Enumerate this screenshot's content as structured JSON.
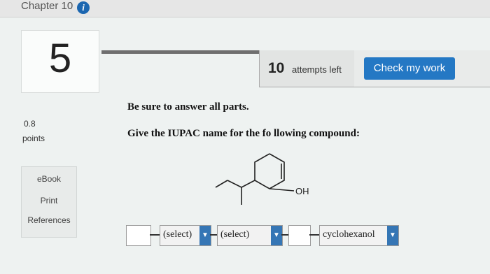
{
  "header": {
    "chapter_title": "Chapter 10",
    "info_icon": "info-icon"
  },
  "question": {
    "number": "5",
    "attempts_count": "10",
    "attempts_label": "attempts left",
    "check_button": "Check my work",
    "instruction": "Be sure to answer all parts.",
    "prompt": "Give the IUPAC name for the fo llowing compound:"
  },
  "points": {
    "value": "0.8",
    "label": "points"
  },
  "sidebar": {
    "ebook": "eBook",
    "print": "Print",
    "references": "References"
  },
  "molecule": {
    "label": "OH"
  },
  "answer": {
    "select1": "(select)",
    "select2": "(select)",
    "select3": "cyclohexanol"
  },
  "colors": {
    "accent": "#2478c4",
    "dropdown_arrow": "#3576b5"
  }
}
